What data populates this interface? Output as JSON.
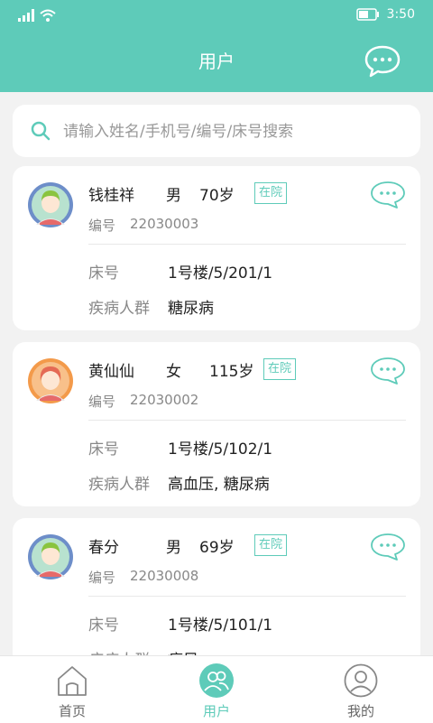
{
  "status_bar": {
    "time": "3:50"
  },
  "header": {
    "title": "用户"
  },
  "search": {
    "placeholder": "请输入姓名/手机号/编号/床号搜索"
  },
  "colors": {
    "accent": "#5ecbb9"
  },
  "patients": [
    {
      "name": "钱桂祥",
      "gender": "男",
      "age": "70岁",
      "status": "在院",
      "code_label": "编号",
      "code": "22030003",
      "bed_label": "床号",
      "bed": "1号楼/5/201/1",
      "disease_label": "疾病人群",
      "disease": "糖尿病",
      "avatar": "green-avatar-icon"
    },
    {
      "name": "黄仙仙",
      "gender": "女",
      "age": "115岁",
      "status": "在院",
      "code_label": "编号",
      "code": "22030002",
      "bed_label": "床号",
      "bed": "1号楼/5/102/1",
      "disease_label": "疾病人群",
      "disease": "高血压, 糖尿病",
      "avatar": "orange-avatar-icon"
    },
    {
      "name": "春分",
      "gender": "男",
      "age": "69岁",
      "status": "在院",
      "code_label": "编号",
      "code": "22030008",
      "bed_label": "床号",
      "bed": "1号楼/5/101/1",
      "disease_label": "疾病人群",
      "disease": "痛风",
      "avatar": "green-avatar-icon"
    }
  ],
  "tabs": [
    {
      "label": "首页",
      "icon": "home-icon",
      "active": false
    },
    {
      "label": "用户",
      "icon": "users-icon",
      "active": true
    },
    {
      "label": "我的",
      "icon": "profile-icon",
      "active": false
    }
  ]
}
